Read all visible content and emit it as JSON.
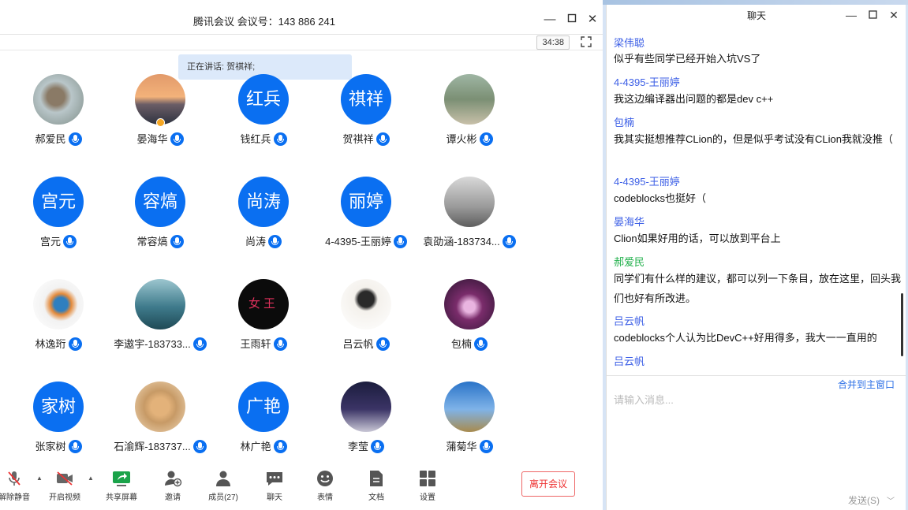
{
  "meeting": {
    "title": "腾讯会议 会议号：143 886 241",
    "timer": "34:38",
    "speaking": "正在讲话: 贺祺祥;"
  },
  "participants": [
    {
      "name": "郝爱民",
      "avatar_kind": "photo",
      "avatar_icon": "hand-sculpture-photo-icon"
    },
    {
      "name": "晏海华",
      "avatar_kind": "photo",
      "avatar_icon": "sunset-photo-icon"
    },
    {
      "name": "钱红兵",
      "avatar_kind": "text",
      "avatar_text": "红兵"
    },
    {
      "name": "贺祺祥",
      "avatar_kind": "text",
      "avatar_text": "祺祥"
    },
    {
      "name": "谭火彬",
      "avatar_kind": "photo",
      "avatar_icon": "people-photo-icon"
    },
    {
      "name": "宫元",
      "avatar_kind": "text",
      "avatar_text": "宫元"
    },
    {
      "name": "常容熇",
      "avatar_kind": "text",
      "avatar_text": "容熇"
    },
    {
      "name": "尚涛",
      "avatar_kind": "text",
      "avatar_text": "尚涛"
    },
    {
      "name": "4-4395-王丽婷",
      "avatar_kind": "text",
      "avatar_text": "丽婷"
    },
    {
      "name": "袁劭涵-183734...",
      "avatar_kind": "photo",
      "avatar_icon": "eiffel-tower-photo-icon"
    },
    {
      "name": "林逸珩",
      "avatar_kind": "photo",
      "avatar_icon": "kingfisher-photo-icon"
    },
    {
      "name": "李遨宇-183733...",
      "avatar_kind": "photo",
      "avatar_icon": "ship-painting-icon"
    },
    {
      "name": "王雨轩",
      "avatar_kind": "photo",
      "avatar_icon": "neon-sign-photo-icon",
      "avatar_text": "女王"
    },
    {
      "name": "吕云帆",
      "avatar_kind": "photo",
      "avatar_icon": "anime-girl-icon"
    },
    {
      "name": "包楠",
      "avatar_kind": "photo",
      "avatar_icon": "throne-room-icon"
    },
    {
      "name": "张家树",
      "avatar_kind": "text",
      "avatar_text": "家树"
    },
    {
      "name": "石渝辉-183737...",
      "avatar_kind": "photo",
      "avatar_icon": "cat-photo-icon"
    },
    {
      "name": "林广艳",
      "avatar_kind": "text",
      "avatar_text": "广艳"
    },
    {
      "name": "李莹",
      "avatar_kind": "photo",
      "avatar_icon": "night-sky-photo-icon"
    },
    {
      "name": "蒲菊华",
      "avatar_kind": "photo",
      "avatar_icon": "tower-photo-icon"
    }
  ],
  "toolbar": {
    "unmute": "解除静音",
    "start_video": "开启视频",
    "share_screen": "共享屏幕",
    "invite": "邀请",
    "members": "成员(27)",
    "chat": "聊天",
    "reactions": "表情",
    "docs": "文档",
    "settings": "设置",
    "leave": "离开会议"
  },
  "chat": {
    "title": "聊天",
    "messages": [
      {
        "sender": "梁伟聪",
        "text": "似乎有些同学已经开始入坑VS了",
        "sender_color": "#3b5ee6"
      },
      {
        "sender": "4-4395-王丽婷",
        "text": "我这边编译器出问题的都是dev c++",
        "sender_color": "#3b5ee6"
      },
      {
        "sender": "包楠",
        "text": "我其实挺想推荐CLion的，但是似乎考试没有CLion我就没推（",
        "sender_color": "#3b5ee6"
      },
      {
        "sender": "4-4395-王丽婷",
        "text": "codeblocks也挺好（",
        "sender_color": "#3b5ee6"
      },
      {
        "sender": "晏海华",
        "text": "Clion如果好用的话，可以放到平台上",
        "sender_color": "#3b5ee6"
      },
      {
        "sender": "郝爱民",
        "text": "同学们有什么样的建议，都可以列一下条目，放在这里，回头我们也好有所改进。",
        "sender_color": "#22b04c"
      },
      {
        "sender": "吕云帆",
        "text": "codeblocks个人认为比DevC++好用得多，我大一一直用的",
        "sender_color": "#3b5ee6"
      },
      {
        "sender": "吕云帆",
        "text": "",
        "sender_color": "#3b5ee6"
      }
    ],
    "merge_link": "合并到主窗口",
    "input_placeholder": "请输入消息...",
    "send_label": "发送(S)"
  }
}
